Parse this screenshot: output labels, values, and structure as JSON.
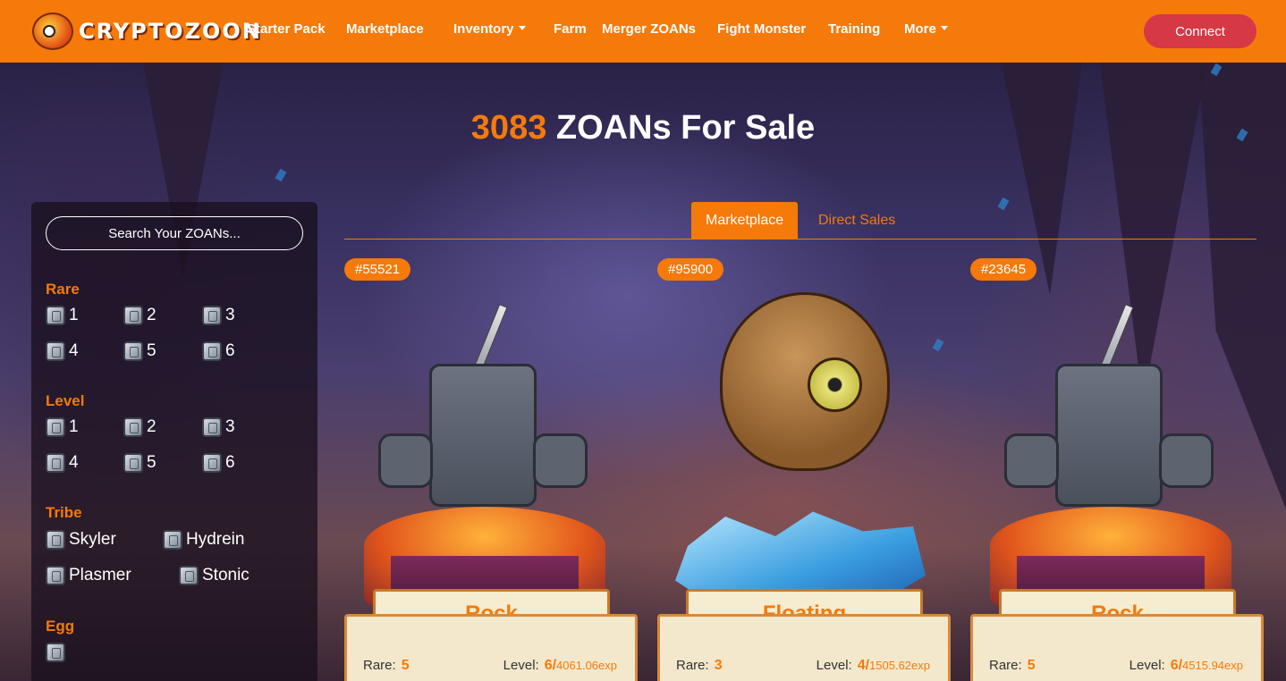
{
  "nav": {
    "brand": "CRYPTOZOON",
    "items": [
      {
        "label": "Starter Pack",
        "dropdown": false
      },
      {
        "label": "Marketplace",
        "dropdown": false
      },
      {
        "label": "Inventory",
        "dropdown": true
      },
      {
        "label": "Farm",
        "dropdown": false
      },
      {
        "label": "Merger ZOANs",
        "dropdown": false
      },
      {
        "label": "Fight Monster",
        "dropdown": false
      },
      {
        "label": "Training",
        "dropdown": false
      },
      {
        "label": "More",
        "dropdown": true
      }
    ],
    "connect_label": "Connect"
  },
  "title": {
    "count": "3083",
    "text": "ZOANs For Sale"
  },
  "filters": {
    "search_placeholder": "Search Your ZOANs...",
    "rare": {
      "label": "Rare",
      "options": [
        "1",
        "2",
        "3",
        "4",
        "5",
        "6"
      ]
    },
    "level": {
      "label": "Level",
      "options": [
        "1",
        "2",
        "3",
        "4",
        "5",
        "6"
      ]
    },
    "tribe": {
      "label": "Tribe",
      "options": [
        "Skyler",
        "Hydrein",
        "Plasmer",
        "Stonic"
      ]
    },
    "egg": {
      "label": "Egg"
    }
  },
  "tabs": [
    {
      "label": "Marketplace",
      "active": true
    },
    {
      "label": "Direct Sales",
      "active": false
    }
  ],
  "cards": [
    {
      "id": "#55521",
      "name": "Rock",
      "rare_label": "Rare:",
      "rare": "5",
      "level_label": "Level:",
      "level": "6/",
      "exp": "4061.06exp",
      "creature": "rock-golem"
    },
    {
      "id": "#95900",
      "name": "Floating",
      "rare_label": "Rare:",
      "rare": "3",
      "level_label": "Level:",
      "level": "4/",
      "exp": "1505.62exp",
      "creature": "floating-rock-monster"
    },
    {
      "id": "#23645",
      "name": "Rock",
      "rare_label": "Rare:",
      "rare": "5",
      "level_label": "Level:",
      "level": "6/",
      "exp": "4515.94exp",
      "creature": "rock-golem"
    }
  ],
  "colors": {
    "accent": "#f57a0a",
    "connect": "#d63845",
    "sidebar": "#19101e"
  }
}
